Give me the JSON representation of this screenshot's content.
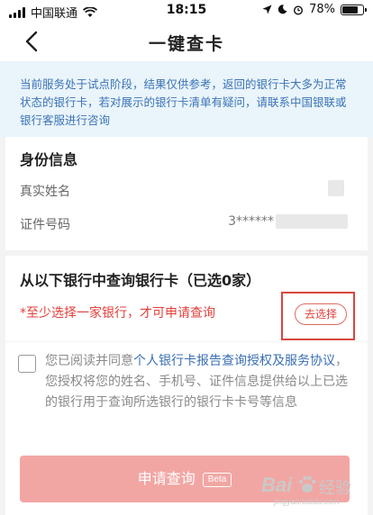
{
  "status_bar": {
    "carrier": "中国联通",
    "time": "18:15",
    "battery": "78%",
    "battery_level": 0.78
  },
  "nav": {
    "title": "一键查卡",
    "back_icon": "chevron-left-icon"
  },
  "notice": {
    "text": "当前服务处于试点阶段，结果仅供参考，返回的银行卡大多为正常状态的银行卡，若对展示的银行卡清单有疑问，请联系中国银联或银行客服进行咨询"
  },
  "identity": {
    "title": "身份信息",
    "name_label": "真实姓名",
    "id_label": "证件号码",
    "id_value": "3******"
  },
  "banks": {
    "title": "从以下银行中查询银行卡（已选0家）",
    "warning": "*至少选择一家银行，才可申请查询",
    "select_button": "去选择"
  },
  "agreement": {
    "prefix": "您已阅读并同意",
    "link": "个人银行卡报告查询授权及服务协议",
    "suffix": "，您授权将您的姓名、手机号、证件信息提供给以上已选的银行用于查询所选银行的银行卡卡号等信息"
  },
  "submit": {
    "label": "申请查询",
    "badge": "Beta"
  },
  "watermark": {
    "brand": "Bai",
    "product": "经验",
    "url": "jingyan.baidu.com"
  },
  "colors": {
    "accent_red": "#e0403c",
    "link_blue": "#3a6fb3",
    "notice_bg": "#eaf4fb",
    "button_disabled": "#f2a6a3"
  }
}
